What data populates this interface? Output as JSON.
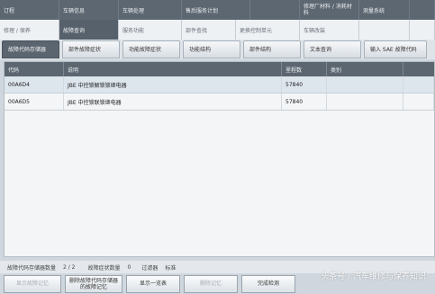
{
  "menu_row1": [
    "订程",
    "车辆信息",
    "车辆处理",
    "售后服务计划",
    "",
    "修理厂材料 / 消耗材料",
    "测量系统",
    ""
  ],
  "menu_row2": [
    "修理 / 保养",
    "故障查询",
    "服务功能",
    "部件查找",
    "更换控制单元",
    "车辆改装",
    "",
    ""
  ],
  "tabs": [
    "故障代码存储器",
    "部件故障症状",
    "功能故障症状",
    "功能结构",
    "部件结构",
    "文本查询",
    "输入 SAE 故障代码"
  ],
  "table": {
    "headers": [
      "代码",
      "说明",
      "里程数",
      "类别",
      ""
    ],
    "rows": [
      {
        "code": "00A6D4",
        "desc": "JBE 中控锁解锁锁继电器",
        "mileage": "57840",
        "category": ""
      },
      {
        "code": "00A6D5",
        "desc": "JBE 中控锁联锁继电器",
        "mileage": "57840",
        "category": ""
      }
    ]
  },
  "status": {
    "fault_count_label": "故障代码存储器数量",
    "fault_count": "2 / 2",
    "symptom_count_label": "故障症状数量",
    "symptom_count": "0",
    "filter_label": "过滤器",
    "filter_value": "标准"
  },
  "buttons": [
    "显示故障记忆",
    "删除故障代码存储器的故障记忆",
    "显示一览表",
    "删除记忆",
    "完成检测"
  ],
  "watermark": "头条号 / 汽车维修与保养知识"
}
